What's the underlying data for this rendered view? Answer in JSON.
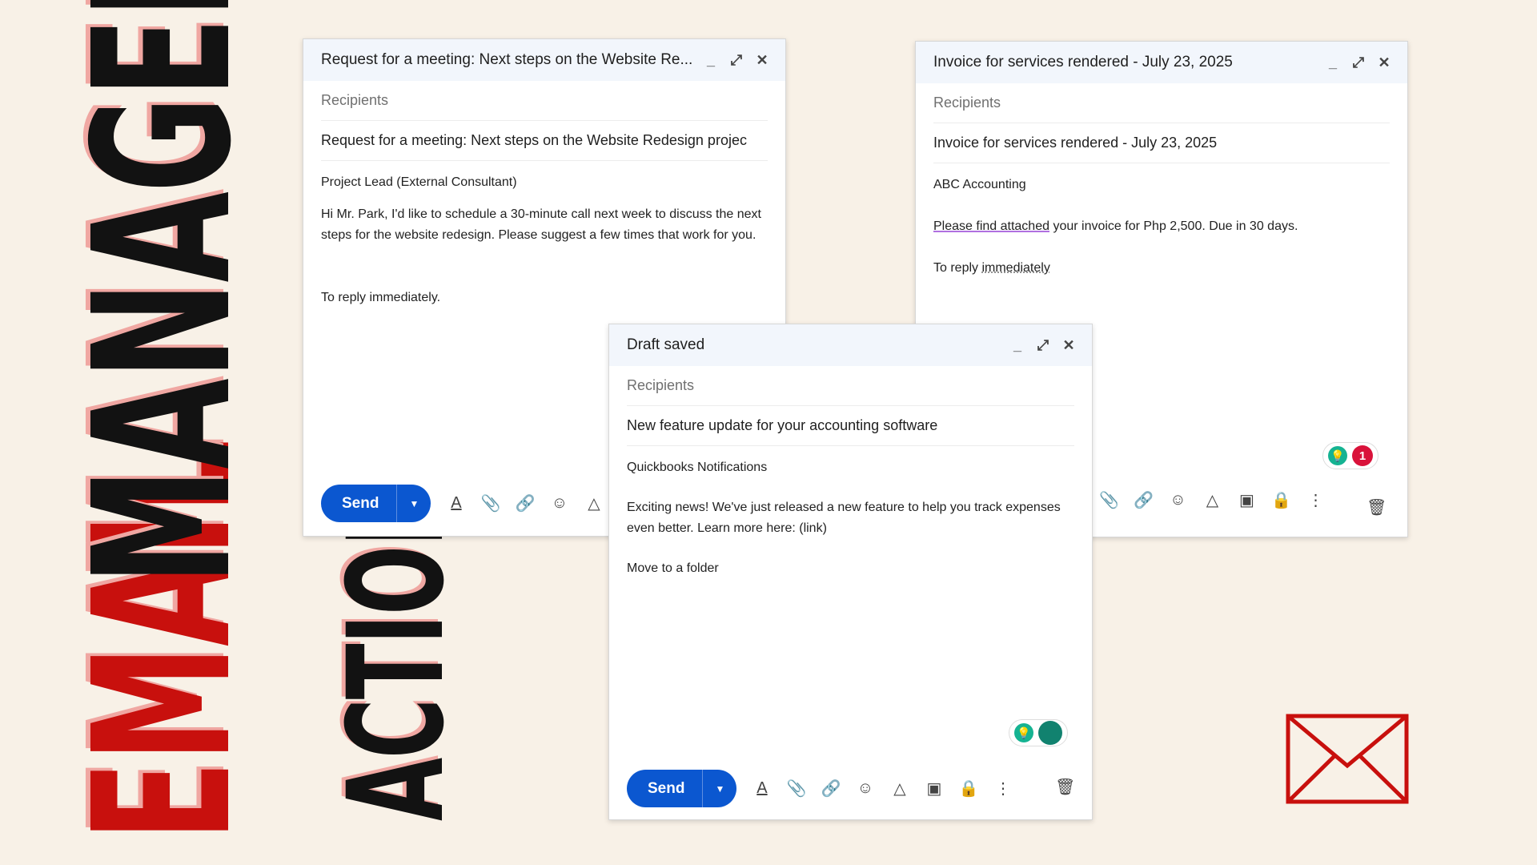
{
  "titles": {
    "line1": "EMAIL",
    "line2": "MANAGEMENT",
    "line3": "ACTIONS"
  },
  "colors": {
    "background": "#f8f1e7",
    "red": "#c8100d",
    "black": "#121212",
    "shadow_pink": "#f0a7a2",
    "send_blue": "#0b57d0"
  },
  "window1": {
    "title": "Request for a meeting: Next steps on the Website Re...",
    "recipients_placeholder": "Recipients",
    "subject": "Request for a meeting: Next steps on the Website Redesign projec",
    "sender": "Project Lead (External Consultant)",
    "body": "Hi Mr. Park, I'd like to schedule a 30-minute call next week to discuss the next steps for the website redesign. Please suggest a few times that work for you.",
    "action": "To reply immediately.",
    "send_label": "Send"
  },
  "window2": {
    "title": "Invoice for services rendered - July 23, 2025",
    "recipients_placeholder": "Recipients",
    "subject": "Invoice for services rendered - July 23, 2025",
    "sender": "ABC Accounting",
    "body_part1": "Please find attached",
    "body_part2": " your invoice for Php 2,500. Due in 30 days.",
    "action_part1": "To reply ",
    "action_part2": "immediately",
    "grammarly_count": "1"
  },
  "window3": {
    "title": "Draft saved",
    "recipients_placeholder": "Recipients",
    "subject": "New feature update for your accounting software",
    "sender": "Quickbooks Notifications",
    "body": "Exciting news! We've just released a new feature to help you track expenses even better. Learn more here: (link)",
    "action": "Move to a folder",
    "send_label": "Send"
  },
  "icons": {
    "minimize": "minimize-icon",
    "expand": "expand-icon",
    "close": "close-icon",
    "format": "text-format-icon",
    "attach": "paperclip-icon",
    "link": "link-icon",
    "emoji": "emoji-icon",
    "drive": "drive-icon",
    "photo": "photo-icon",
    "lock": "confidential-lock-icon",
    "more": "more-options-icon",
    "trash": "trash-icon",
    "envelope": "envelope-icon"
  }
}
